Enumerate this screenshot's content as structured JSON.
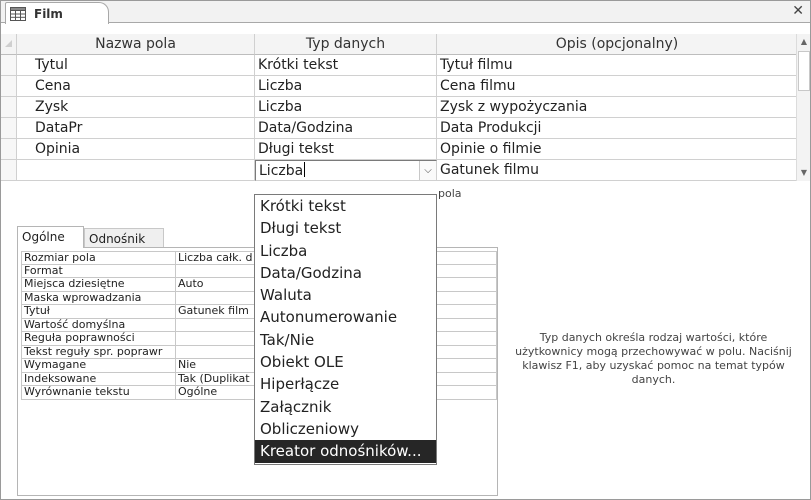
{
  "tab": {
    "title": "Film"
  },
  "grid": {
    "headers": {
      "name": "Nazwa pola",
      "type": "Typ danych",
      "desc": "Opis (opcjonalny)"
    },
    "rows": [
      {
        "name": "Tytul",
        "type": "Krótki tekst",
        "desc": "Tytuł filmu"
      },
      {
        "name": "Cena",
        "type": "Liczba",
        "desc": "Cena filmu"
      },
      {
        "name": "Zysk",
        "type": "Liczba",
        "desc": "Zysk z wypożyczania"
      },
      {
        "name": "DataPr",
        "type": "Data/Godzina",
        "desc": "Data Produkcji"
      },
      {
        "name": "Opinia",
        "type": "Długi tekst",
        "desc": "Opinie o filmie"
      }
    ],
    "active_row": {
      "name": "",
      "type": "Liczba",
      "desc": "Gatunek filmu"
    },
    "below_text": "pola"
  },
  "properties": {
    "tabs": {
      "general": "Ogólne",
      "lookup": "Odnośnik"
    },
    "rows": [
      {
        "name": "Rozmiar pola",
        "value": "Liczba całk. d"
      },
      {
        "name": "Format",
        "value": ""
      },
      {
        "name": "Miejsca dziesiętne",
        "value": "Auto"
      },
      {
        "name": "Maska wprowadzania",
        "value": ""
      },
      {
        "name": "Tytuł",
        "value": "Gatunek film"
      },
      {
        "name": "Wartość domyślna",
        "value": ""
      },
      {
        "name": "Reguła poprawności",
        "value": ""
      },
      {
        "name": "Tekst reguły spr. poprawr",
        "value": ""
      },
      {
        "name": "Wymagane",
        "value": "Nie"
      },
      {
        "name": "Indeksowane",
        "value": "Tak (Duplikat"
      },
      {
        "name": "Wyrównanie tekstu",
        "value": "Ogólne"
      }
    ]
  },
  "help_text": "Typ danych określa rodzaj wartości, które użytkownicy mogą przechowywać w polu. Naciśnij klawisz F1, aby uzyskać pomoc na temat typów danych.",
  "dropdown": {
    "options": [
      "Krótki tekst",
      "Długi tekst",
      "Liczba",
      "Data/Godzina",
      "Waluta",
      "Autonumerowanie",
      "Tak/Nie",
      "Obiekt OLE",
      "Hiperłącze",
      "Załącznik",
      "Obliczeniowy",
      "Kreator odnośników..."
    ],
    "highlighted": "Kreator odnośników..."
  },
  "icons": {
    "tab": "table-icon",
    "close": "close-icon",
    "combo": "chevron-down-icon"
  }
}
